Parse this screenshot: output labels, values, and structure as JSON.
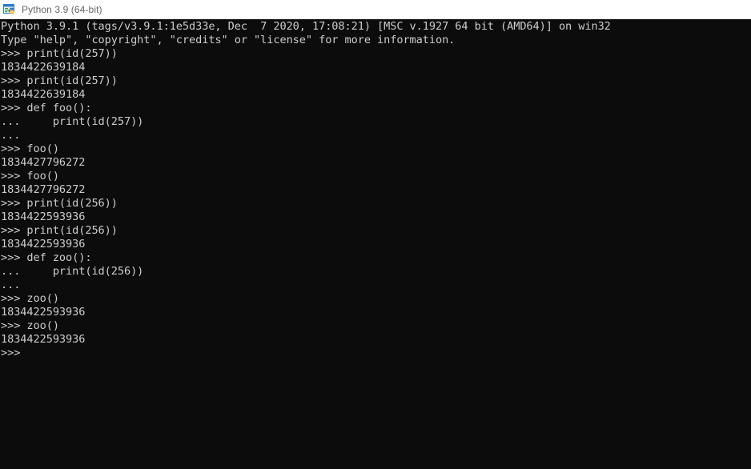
{
  "window": {
    "titlebar": {
      "icon_name": "python-console-icon",
      "title": "Python 3.9 (64-bit)"
    },
    "colors": {
      "titlebar_background": "#ffffff",
      "titlebar_text": "#666666",
      "console_background": "#0c0c0c",
      "console_text": "#cccccc"
    }
  },
  "console": {
    "lines": [
      "Python 3.9.1 (tags/v3.9.1:1e5d33e, Dec  7 2020, 17:08:21) [MSC v.1927 64 bit (AMD64)] on win32",
      "Type \"help\", \"copyright\", \"credits\" or \"license\" for more information.",
      ">>> print(id(257))",
      "1834422639184",
      ">>> print(id(257))",
      "1834422639184",
      ">>> def foo():",
      "...     print(id(257))",
      "...",
      ">>> foo()",
      "1834427796272",
      ">>> foo()",
      "1834427796272",
      ">>> print(id(256))",
      "1834422593936",
      ">>> print(id(256))",
      "1834422593936",
      ">>> def zoo():",
      "...     print(id(256))",
      "...",
      ">>> zoo()",
      "1834422593936",
      ">>> zoo()",
      "1834422593936",
      ">>>"
    ],
    "prompt": ">>>",
    "continuation_prompt": "..."
  }
}
